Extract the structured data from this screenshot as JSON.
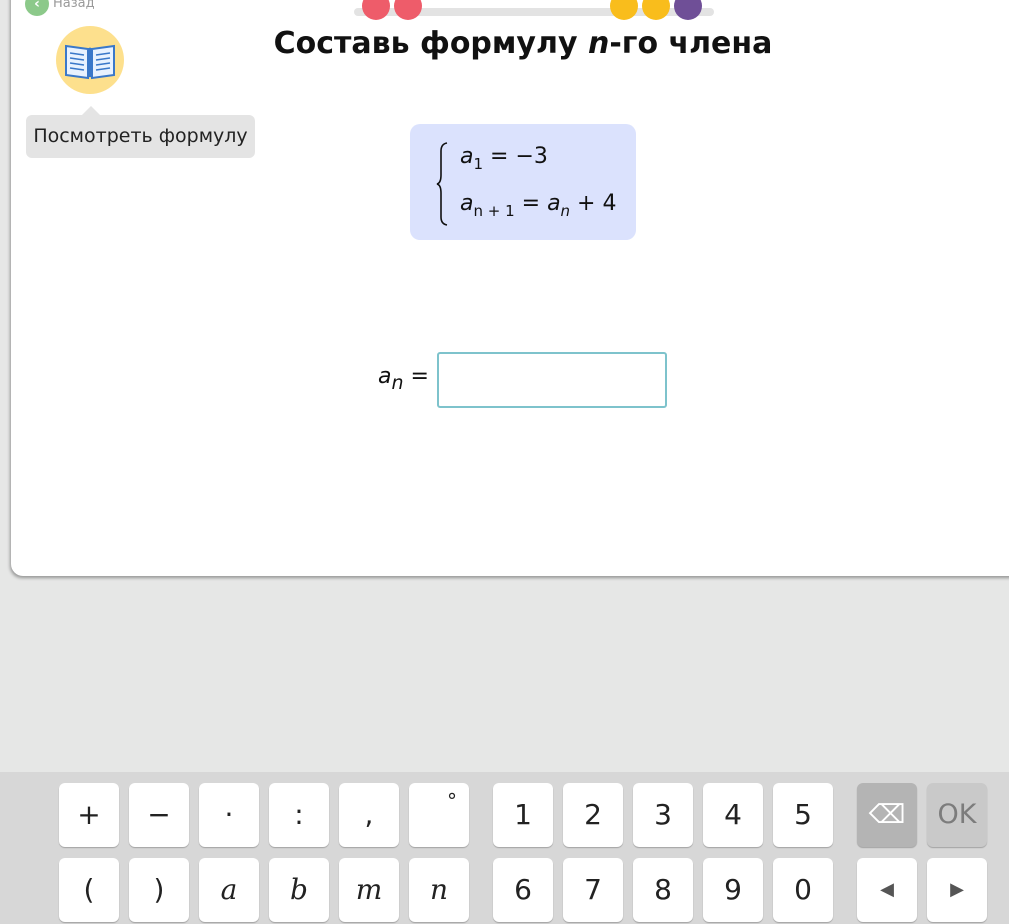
{
  "nav": {
    "back_label": "Назад"
  },
  "progress": {
    "dots": [
      {
        "color": "#ee5c6a"
      },
      {
        "color": "#ee5c6a"
      },
      {
        "color": "#f9bd1c"
      },
      {
        "color": "#f9bd1c"
      },
      {
        "color": "#6f4f97"
      }
    ]
  },
  "hint": {
    "label": "Посмотреть формулу"
  },
  "task": {
    "title_prefix": "Составь формулу ",
    "title_var": "n",
    "title_suffix": "-го члена"
  },
  "system": {
    "eq1": {
      "var": "a",
      "sub": "1",
      "rhs": " = −3"
    },
    "eq2": {
      "var": "a",
      "sub": "n + 1",
      "mid": " = ",
      "rhs_var": "a",
      "rhs_sub": "n",
      "rhs_tail": " + 4"
    }
  },
  "answer": {
    "var": "a",
    "sub": "n",
    "equals": " =",
    "value": ""
  },
  "keyboard": {
    "row1": [
      "+",
      "−",
      "·",
      ":",
      ",",
      "°",
      "1",
      "2",
      "3",
      "4",
      "5",
      "⌫",
      "OK"
    ],
    "row2": [
      "(",
      ")",
      "a",
      "b",
      "m",
      "n",
      "6",
      "7",
      "8",
      "9",
      "0",
      "◀",
      "▶"
    ]
  },
  "colors": {
    "system_bg": "#dbe2fd",
    "input_border": "#7ec3cc",
    "hint_icon_bg": "#fde08d"
  }
}
